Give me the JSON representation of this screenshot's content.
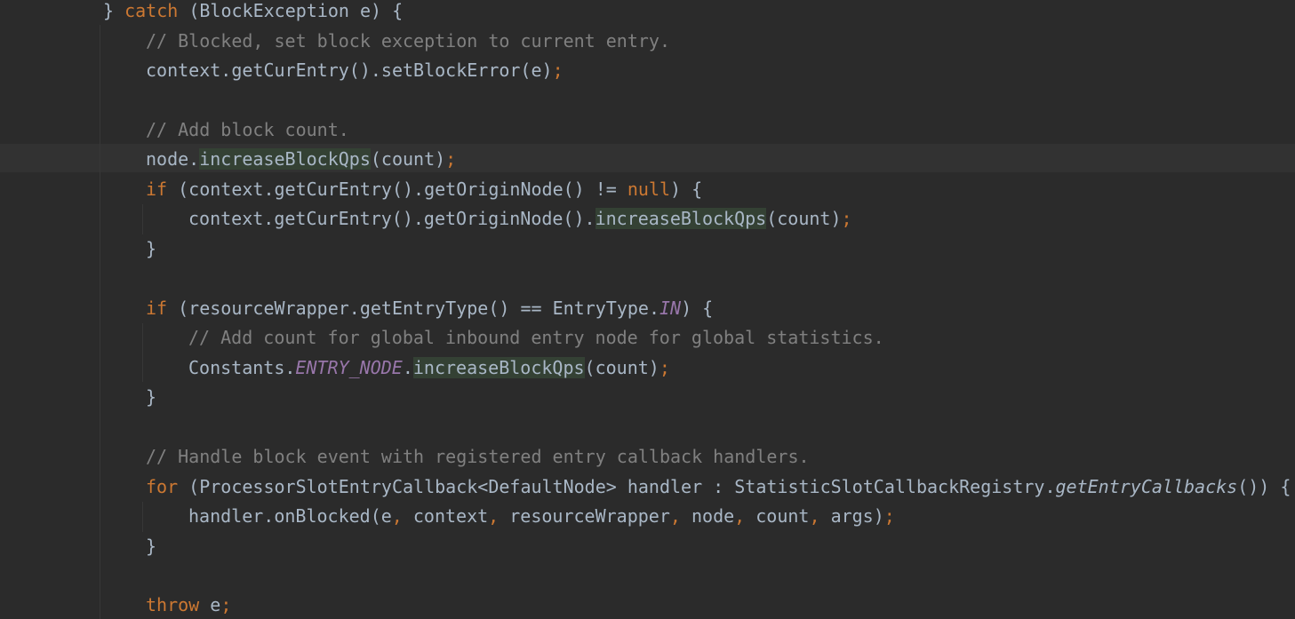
{
  "editor": {
    "lines": [
      [
        {
          "t": "} ",
          "c": "pl"
        },
        {
          "t": "catch",
          "c": "kw"
        },
        {
          "t": " (BlockException e) {",
          "c": "pl"
        }
      ],
      [
        {
          "t": "// Blocked, set block exception to current entry.",
          "c": "cm"
        }
      ],
      [
        {
          "t": "context.getCurEntry().setBlockError(e)",
          "c": "pl"
        },
        {
          "t": ";",
          "c": "kw"
        }
      ],
      [],
      [
        {
          "t": "// Add block count.",
          "c": "cm"
        }
      ],
      [
        {
          "t": "node.",
          "c": "pl"
        },
        {
          "t": "increaseBlockQps",
          "c": "hl"
        },
        {
          "t": "(count)",
          "c": "pl"
        },
        {
          "t": ";",
          "c": "kw"
        }
      ],
      [
        {
          "t": "if",
          "c": "kw"
        },
        {
          "t": " (context.getCurEntry().getOriginNode() != ",
          "c": "pl"
        },
        {
          "t": "null",
          "c": "kw"
        },
        {
          "t": ") {",
          "c": "pl"
        }
      ],
      [
        {
          "t": "context.getCurEntry().getOriginNode().",
          "c": "pl"
        },
        {
          "t": "increaseBlockQps",
          "c": "hl"
        },
        {
          "t": "(count)",
          "c": "pl"
        },
        {
          "t": ";",
          "c": "kw"
        }
      ],
      [
        {
          "t": "}",
          "c": "pl"
        }
      ],
      [],
      [
        {
          "t": "if",
          "c": "kw"
        },
        {
          "t": " (resourceWrapper.getEntryType() == EntryType.",
          "c": "pl"
        },
        {
          "t": "IN",
          "c": "st"
        },
        {
          "t": ") {",
          "c": "pl"
        }
      ],
      [
        {
          "t": "// Add count for global inbound entry node for global statistics.",
          "c": "cm"
        }
      ],
      [
        {
          "t": "Constants.",
          "c": "pl"
        },
        {
          "t": "ENTRY_NODE",
          "c": "st"
        },
        {
          "t": ".",
          "c": "pl"
        },
        {
          "t": "increaseBlockQps",
          "c": "hl"
        },
        {
          "t": "(count)",
          "c": "pl"
        },
        {
          "t": ";",
          "c": "kw"
        }
      ],
      [
        {
          "t": "}",
          "c": "pl"
        }
      ],
      [],
      [
        {
          "t": "// Handle block event with registered entry callback handlers.",
          "c": "cm"
        }
      ],
      [
        {
          "t": "for",
          "c": "kw"
        },
        {
          "t": " (ProcessorSlotEntryCallback<DefaultNode> handler : StatisticSlotCallbackRegistry.",
          "c": "pl"
        },
        {
          "t": "getEntryCallbacks",
          "c": "fn"
        },
        {
          "t": "()) {",
          "c": "pl"
        }
      ],
      [
        {
          "t": "handler.onBlocked(e",
          "c": "pl"
        },
        {
          "t": ", ",
          "c": "kw"
        },
        {
          "t": "context",
          "c": "pl"
        },
        {
          "t": ", ",
          "c": "kw"
        },
        {
          "t": "resourceWrapper",
          "c": "pl"
        },
        {
          "t": ", ",
          "c": "kw"
        },
        {
          "t": "node",
          "c": "pl"
        },
        {
          "t": ", ",
          "c": "kw"
        },
        {
          "t": "count",
          "c": "pl"
        },
        {
          "t": ", ",
          "c": "kw"
        },
        {
          "t": "args)",
          "c": "pl"
        },
        {
          "t": ";",
          "c": "kw"
        }
      ],
      [
        {
          "t": "}",
          "c": "pl"
        }
      ],
      [],
      [
        {
          "t": "throw",
          "c": "kw"
        },
        {
          "t": " e",
          "c": "pl"
        },
        {
          "t": ";",
          "c": "kw"
        }
      ]
    ]
  }
}
